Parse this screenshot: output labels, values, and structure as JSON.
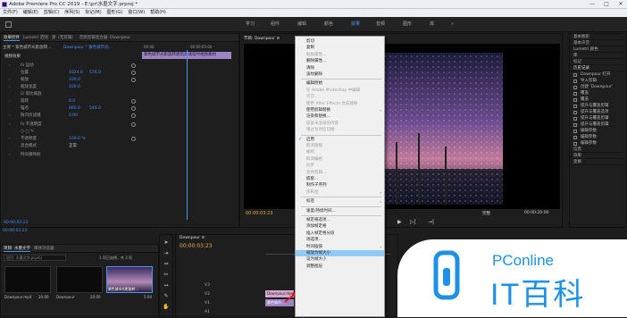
{
  "window": {
    "title": "Adobe Premiere Pro CC 2019 - E:\\pr\\水墨文字.prproj *",
    "min": "—",
    "max": "□",
    "close": "✕"
  },
  "menu": [
    "文件(F)",
    "编辑(E)",
    "剪辑(C)",
    "序列(S)",
    "标记(M)",
    "图形(G)",
    "窗口(W)",
    "帮助(H)"
  ],
  "workspaces": [
    "学习",
    "组件",
    "编辑",
    "颜色",
    "效果",
    "音频",
    "图形",
    "库"
  ],
  "workspace_active": "效果",
  "ws_more": "»",
  "effect_controls": {
    "tabs": [
      "效果控件",
      "Lumetri 范围",
      "源（无剪辑）",
      "音频剪辑混合器: Downpour"
    ],
    "clip_name": "主要 * 紫色城市光影旋转...",
    "seq_name": "Downpour * 紫色城市光...",
    "timecode_start": "00:00",
    "timecode_end": "00:00:05:00",
    "clip_bar_label": "紫色城市光影旋转建筑高速延时视频素材",
    "section_video": "视频效果",
    "rows": [
      {
        "arrow": "›",
        "label": "fx 运动",
        "v1": "",
        "v2": ""
      },
      {
        "arrow": "",
        "label": "位置",
        "v1": "1024.0",
        "v2": "576.0"
      },
      {
        "arrow": "›",
        "label": "缩放",
        "v1": "100.0",
        "v2": ""
      },
      {
        "arrow": "›",
        "label": "缩放宽度",
        "v1": "100.0",
        "v2": ""
      },
      {
        "arrow": "",
        "label": "☑ 等比缩放",
        "v1": "",
        "v2": ""
      },
      {
        "arrow": "›",
        "label": "旋转",
        "v1": "0.0",
        "v2": ""
      },
      {
        "arrow": "",
        "label": "锚点",
        "v1": "960.0",
        "v2": "540.0"
      },
      {
        "arrow": "›",
        "label": "防闪烁滤镜",
        "v1": "0.00",
        "v2": ""
      },
      {
        "arrow": "›",
        "label": "fx 不透明度",
        "v1": "",
        "v2": ""
      },
      {
        "arrow": "",
        "label": "○ □ ✎",
        "v1": "",
        "v2": ""
      },
      {
        "arrow": "›",
        "label": "不透明度",
        "v1": "100.0 %",
        "v2": ""
      },
      {
        "arrow": "",
        "label": "混合模式",
        "v1": "正常",
        "v2": ""
      },
      {
        "arrow": "›",
        "label": "时间重映射",
        "v1": "",
        "v2": ""
      }
    ],
    "timecode": "00:00:03:23"
  },
  "program": {
    "tab": "节目: Downpour ≡",
    "timecode": "00:00:03:23",
    "fit": "完整",
    "duration": "00:00:20:00"
  },
  "context_menu": {
    "items": [
      {
        "label": "剪切",
        "type": "item"
      },
      {
        "label": "复制",
        "type": "item"
      },
      {
        "label": "粘贴属性...",
        "type": "dis"
      },
      {
        "label": "删除属性...",
        "type": "item"
      },
      {
        "label": "清除",
        "type": "item"
      },
      {
        "label": "波纹删除",
        "type": "item"
      },
      {
        "label": "",
        "type": "sep"
      },
      {
        "label": "编辑原始",
        "type": "item"
      },
      {
        "label": "在 Adobe Photoshop 中编辑",
        "type": "dis"
      },
      {
        "label": "许可...",
        "type": "dis"
      },
      {
        "label": "使用 After Effects 合成替换",
        "type": "dis"
      },
      {
        "label": "使用剪辑替换",
        "type": "item",
        "sub": "›"
      },
      {
        "label": "渲染和替换...",
        "type": "item"
      },
      {
        "label": "恢复未渲染的内容",
        "type": "dis"
      },
      {
        "label": "限过为对应切换",
        "type": "dis"
      },
      {
        "label": "",
        "type": "sep"
      },
      {
        "label": "启用",
        "type": "item",
        "check": "✓"
      },
      {
        "label": "取消链接",
        "type": "dis"
      },
      {
        "label": "编组",
        "type": "dis"
      },
      {
        "label": "取消编组",
        "type": "dis"
      },
      {
        "label": "同步",
        "type": "dis"
      },
      {
        "label": "合并剪辑...",
        "type": "dis"
      },
      {
        "label": "嵌套...",
        "type": "item"
      },
      {
        "label": "制作子序列",
        "type": "item"
      },
      {
        "label": "多机位",
        "type": "dis",
        "sub": "›"
      },
      {
        "label": "",
        "type": "sep"
      },
      {
        "label": "标签",
        "type": "item",
        "sub": "›"
      },
      {
        "label": "",
        "type": "sep"
      },
      {
        "label": "速度/持续时间...",
        "type": "item"
      },
      {
        "label": "",
        "type": "sep"
      },
      {
        "label": "帧定格选项...",
        "type": "item"
      },
      {
        "label": "添加帧定格",
        "type": "item"
      },
      {
        "label": "插入帧定格分段",
        "type": "item"
      },
      {
        "label": "场选项...",
        "type": "item"
      },
      {
        "label": "时间插值",
        "type": "item",
        "sub": "›"
      },
      {
        "label": "缩放为帧大小",
        "type": "hl"
      },
      {
        "label": "设为帧大小",
        "type": "item"
      },
      {
        "label": "调整图层",
        "type": "item"
      }
    ]
  },
  "right_panel": {
    "items": [
      "基本图形",
      "基本声音",
      "Lumetri 颜色",
      "库",
      "标记"
    ],
    "history_title": "历史记录",
    "history": [
      "Downpour 打开",
      "导入剪辑",
      "创建 'Downpour'",
      "覆盖",
      "覆盖",
      "提升与覆盖剪辑",
      "提升与覆盖选项",
      "提升与覆盖剪辑",
      "提升与覆盖剪辑",
      "编辑参数",
      "编辑参数",
      "编辑参数"
    ],
    "lower": [
      "信息",
      "效果",
      "变换"
    ]
  },
  "project": {
    "tabs": [
      "项目: 水墨文字",
      "媒体浏览器"
    ],
    "search_placeholder": "项目: 水墨文字.prproj",
    "selection_info": "1 项已选择，共 3 项",
    "thumbs": [
      {
        "name": "Downpour.mp4",
        "duration": "20:00"
      },
      {
        "name": "Downpour",
        "duration": "20:00"
      },
      {
        "name": "紫色城市光影旋转...",
        "duration": "5:00"
      }
    ]
  },
  "timeline": {
    "tab": "Downpour ≡",
    "timecode": "00:00:03:23",
    "tracks": [
      "V3",
      "V2",
      "V1",
      "A1"
    ],
    "clip1": "Downpour.mp4",
    "clip2": "紫色城市..."
  },
  "left_status": "00:00:03:23",
  "watermark": {
    "brand_small": "PConline",
    "brand_big": "IT百科"
  },
  "colors": {
    "accent": "#4d95ff",
    "menu_highlight": "#91c9f7",
    "clip_purple": "#9b85c6"
  }
}
